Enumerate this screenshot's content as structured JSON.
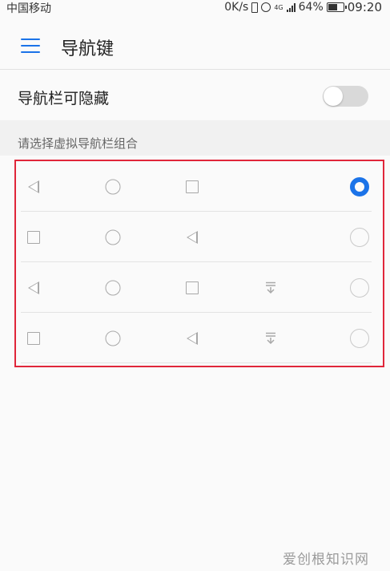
{
  "status_bar": {
    "carrier": "中国移动",
    "speed": "0K/s",
    "network": "4G",
    "battery": "64%",
    "time": "09:20"
  },
  "toolbar": {
    "title": "导航键"
  },
  "setting": {
    "hide_nav_label": "导航栏可隐藏",
    "hide_nav_enabled": false
  },
  "section": {
    "title": "请选择虚拟导航栏组合"
  },
  "options": [
    {
      "icons": [
        "back",
        "home",
        "recent"
      ],
      "selected": true
    },
    {
      "icons": [
        "recent",
        "home",
        "back"
      ],
      "selected": false
    },
    {
      "icons": [
        "back",
        "home",
        "recent",
        "notification"
      ],
      "selected": false
    },
    {
      "icons": [
        "recent",
        "home",
        "back",
        "notification"
      ],
      "selected": false
    }
  ],
  "watermark": "爱创根知识网",
  "colors": {
    "accent": "#1b73e8",
    "highlight_border": "#e0263a",
    "icon_gray": "#a8a8a8"
  }
}
